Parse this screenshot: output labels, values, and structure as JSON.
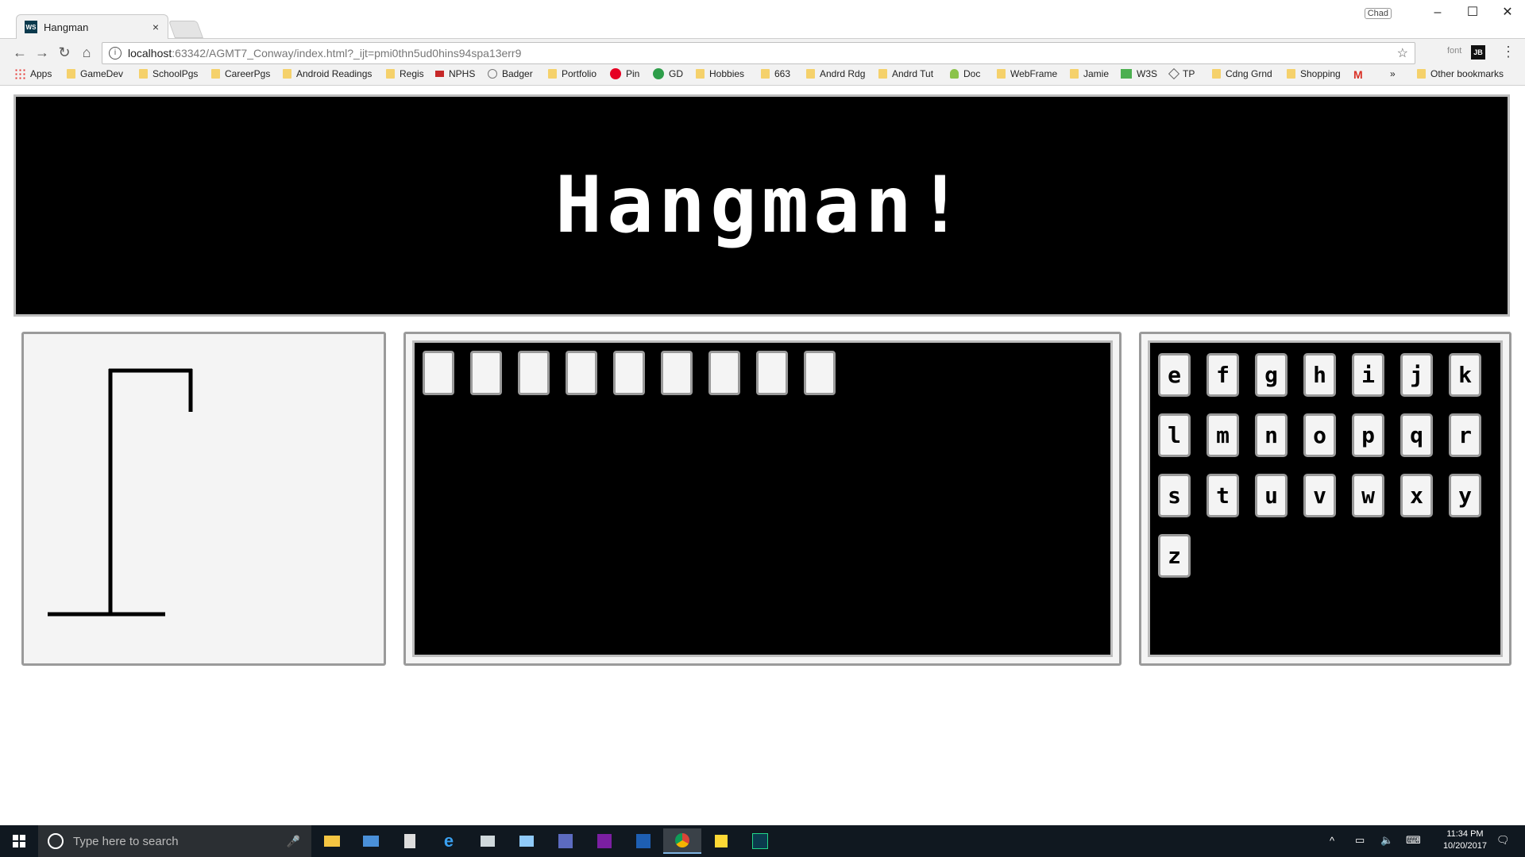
{
  "browser": {
    "tab_title": "Hangman",
    "tab_close": "×",
    "profile": "Chad",
    "window_controls": [
      "–",
      "☐",
      "✕"
    ],
    "url_host": "localhost",
    "url_path": ":63342/AGMT7_Conway/index.html?_ijt=pmi0thn5ud0hins94spa13err9",
    "ext_font": "font",
    "ext_jb": "JB",
    "bookmarks": [
      {
        "label": "Apps",
        "icon": "apps-grid-icon"
      },
      {
        "label": "GameDev",
        "icon": "folder-icon"
      },
      {
        "label": "SchoolPgs",
        "icon": "folder-icon"
      },
      {
        "label": "CareerPgs",
        "icon": "folder-icon"
      },
      {
        "label": "Android Readings",
        "icon": "folder-icon"
      },
      {
        "label": "Regis",
        "icon": "folder-icon"
      },
      {
        "label": "NPHS",
        "icon": "flag-icon"
      },
      {
        "label": "Badger",
        "icon": "badger-icon"
      },
      {
        "label": "Portfolio",
        "icon": "folder-icon"
      },
      {
        "label": "Pin",
        "icon": "pinterest-icon"
      },
      {
        "label": "GD",
        "icon": "gd-icon"
      },
      {
        "label": "Hobbies",
        "icon": "folder-icon"
      },
      {
        "label": "663",
        "icon": "folder-icon"
      },
      {
        "label": "Andrd Rdg",
        "icon": "folder-icon"
      },
      {
        "label": "Andrd Tut",
        "icon": "folder-icon"
      },
      {
        "label": "Doc",
        "icon": "android-icon"
      },
      {
        "label": "WebFrame",
        "icon": "folder-icon"
      },
      {
        "label": "Jamie",
        "icon": "folder-icon"
      },
      {
        "label": "W3S",
        "icon": "w3s-icon"
      },
      {
        "label": "TP",
        "icon": "tp-icon"
      },
      {
        "label": "Cdng Grnd",
        "icon": "folder-icon"
      },
      {
        "label": "Shopping",
        "icon": "folder-icon"
      }
    ],
    "overflow": "»",
    "other_bookmarks": "Other bookmarks"
  },
  "game": {
    "title": "Hangman!",
    "word_slot_count": 9,
    "letters": [
      "e",
      "f",
      "g",
      "h",
      "i",
      "j",
      "k",
      "l",
      "m",
      "n",
      "o",
      "p",
      "q",
      "r",
      "s",
      "t",
      "u",
      "v",
      "w",
      "x",
      "y",
      "z"
    ]
  },
  "taskbar": {
    "search_placeholder": "Type here to search",
    "time": "11:34 PM",
    "date": "10/20/2017"
  },
  "colors": {
    "panel_bg": "#f4f4f4",
    "panel_border": "#9a9a9a",
    "board_bg": "#000000"
  }
}
